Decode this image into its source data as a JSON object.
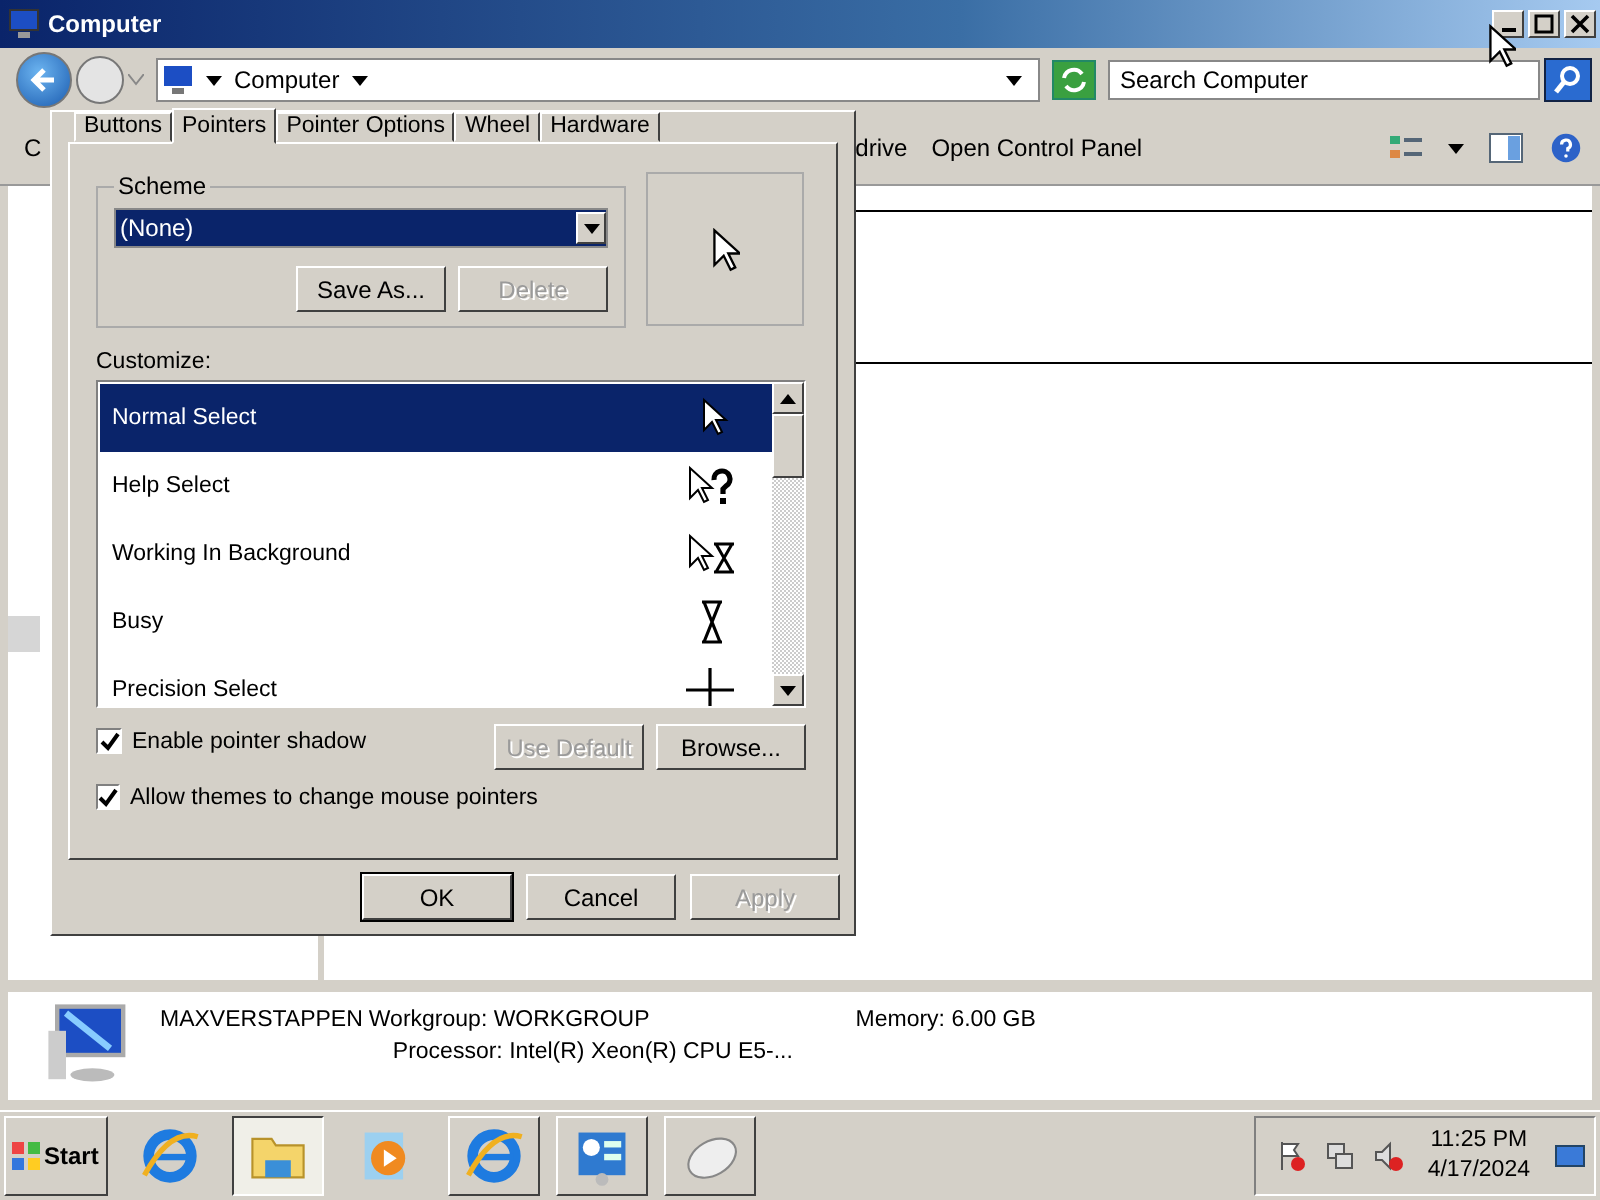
{
  "window": {
    "title": "Computer"
  },
  "address_bar": {
    "path": "Computer",
    "search_placeholder": "Search Computer"
  },
  "toolbar": {
    "items": [
      "C",
      "drive",
      "Open Control Panel"
    ]
  },
  "dialog": {
    "tabs": [
      {
        "label": "Buttons",
        "selected": false
      },
      {
        "label": "Pointers",
        "selected": true
      },
      {
        "label": "Pointer Options",
        "selected": false
      },
      {
        "label": "Wheel",
        "selected": false
      },
      {
        "label": "Hardware",
        "selected": false
      }
    ],
    "scheme": {
      "label": "Scheme",
      "value": "(None)",
      "buttons": [
        {
          "label": "Save As...",
          "disabled": false
        },
        {
          "label": "Delete",
          "disabled": true
        }
      ]
    },
    "customize_label": "Customize:",
    "cursors": [
      {
        "name": "Normal Select",
        "kind": "arrow",
        "selected": true
      },
      {
        "name": "Help Select",
        "kind": "help",
        "selected": false
      },
      {
        "name": "Working In Background",
        "kind": "working",
        "selected": false
      },
      {
        "name": "Busy",
        "kind": "busy",
        "selected": false
      },
      {
        "name": "Precision Select",
        "kind": "cross",
        "selected": false
      }
    ],
    "options": [
      {
        "label": "Enable pointer shadow",
        "checked": true
      },
      {
        "label": "Allow themes to change mouse pointers",
        "checked": true
      }
    ],
    "cursor_buttons": [
      {
        "label": "Use Default",
        "disabled": true
      },
      {
        "label": "Browse...",
        "disabled": false
      }
    ],
    "buttons": [
      {
        "label": "OK",
        "disabled": false
      },
      {
        "label": "Cancel",
        "disabled": false
      },
      {
        "label": "Apply",
        "disabled": true
      }
    ]
  },
  "details": {
    "name": "MAXVERSTAPPEN",
    "workgroup": "Workgroup: WORKGROUP",
    "memory": "Memory: 6.00 GB",
    "processor": "Processor: Intel(R) Xeon(R) CPU E5-..."
  },
  "taskbar": {
    "start": "Start",
    "apps": [
      {
        "kind": "ie",
        "open": false,
        "selected": false
      },
      {
        "kind": "folder",
        "open": true,
        "selected": true
      },
      {
        "kind": "media",
        "open": false,
        "selected": false
      },
      {
        "kind": "ie",
        "open": true,
        "selected": false
      },
      {
        "kind": "control",
        "open": true,
        "selected": false
      },
      {
        "kind": "mouse",
        "open": true,
        "selected": false
      }
    ],
    "tray": [
      {
        "kind": "flag"
      },
      {
        "kind": "network"
      },
      {
        "kind": "volume"
      }
    ],
    "time": "11:25 PM",
    "date": "4/17/2024"
  }
}
